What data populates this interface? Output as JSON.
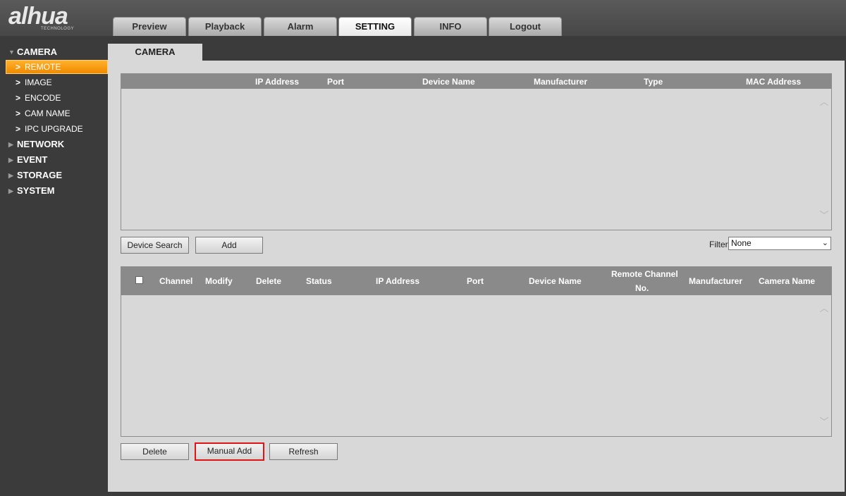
{
  "brand": {
    "logo_text": "alhua",
    "logo_subtext": "TECHNOLOGY"
  },
  "nav_tabs": [
    {
      "label": "Preview"
    },
    {
      "label": "Playback"
    },
    {
      "label": "Alarm"
    },
    {
      "label": "SETTING"
    },
    {
      "label": "INFO"
    },
    {
      "label": "Logout"
    }
  ],
  "active_tab": "SETTING",
  "sidebar": {
    "sections": [
      {
        "label": "CAMERA",
        "expanded": true
      },
      {
        "label": "NETWORK",
        "expanded": false
      },
      {
        "label": "EVENT",
        "expanded": false
      },
      {
        "label": "STORAGE",
        "expanded": false
      },
      {
        "label": "SYSTEM",
        "expanded": false
      }
    ],
    "camera_items": [
      {
        "label": "REMOTE"
      },
      {
        "label": "IMAGE"
      },
      {
        "label": "ENCODE"
      },
      {
        "label": "CAM NAME"
      },
      {
        "label": "IPC UPGRADE"
      }
    ],
    "active_item": "REMOTE"
  },
  "page_tab": "CAMERA",
  "search_table": {
    "columns": [
      "IP Address",
      "Port",
      "Device Name",
      "Manufacturer",
      "Type",
      "MAC Address"
    ],
    "rows": []
  },
  "search_actions": {
    "device_search": "Device Search",
    "add": "Add"
  },
  "filter": {
    "label": "Filter",
    "value": "None"
  },
  "added_table": {
    "columns": [
      "Channel",
      "Modify",
      "Delete",
      "Status",
      "IP Address",
      "Port",
      "Device Name",
      "Remote Channel",
      "No.",
      "Manufacturer",
      "Camera Name"
    ],
    "rows": []
  },
  "added_actions": {
    "delete": "Delete",
    "manual_add": "Manual Add",
    "refresh": "Refresh"
  },
  "colors": {
    "highlight_border": "#e01414",
    "active_menu": "#f5a000",
    "header_gray": "#8a8a8a"
  },
  "icons": {
    "scroll_up": "chevron-up-icon",
    "scroll_down": "chevron-down-icon",
    "dropdown": "chevron-down-icon"
  }
}
